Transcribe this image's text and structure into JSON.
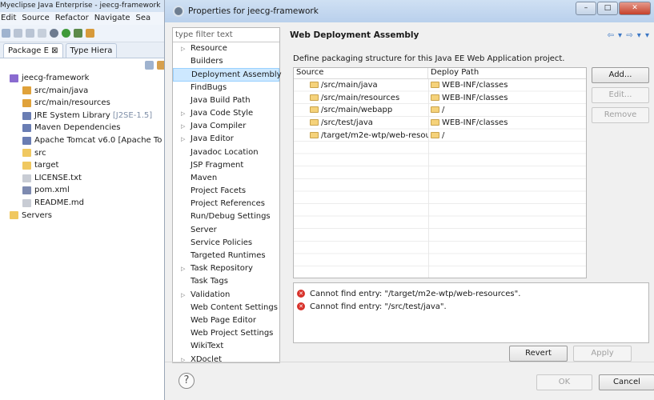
{
  "ide": {
    "title": "Myeclipse Java Enterprise - jeecg-framework",
    "menu": [
      "Edit",
      "Source",
      "Refactor",
      "Navigate",
      "Sea"
    ],
    "tabs": [
      "Package E",
      "Type Hiera"
    ],
    "tree": [
      {
        "label": "jeecg-framework",
        "extra": "",
        "indent": 0,
        "color": "#8a6bd0"
      },
      {
        "label": "src/main/java",
        "extra": "",
        "indent": 1,
        "color": "#e0a23a"
      },
      {
        "label": "src/main/resources",
        "extra": "",
        "indent": 1,
        "color": "#e0a23a"
      },
      {
        "label": "JRE System Library",
        "extra": "[J2SE-1.5]",
        "indent": 1,
        "color": "#6a7db3"
      },
      {
        "label": "Maven Dependencies",
        "extra": "",
        "indent": 1,
        "color": "#6a7db3"
      },
      {
        "label": "Apache Tomcat v6.0 [Apache To",
        "extra": "",
        "indent": 1,
        "color": "#6a7db3"
      },
      {
        "label": "src",
        "extra": "",
        "indent": 1,
        "color": "#f0c860"
      },
      {
        "label": "target",
        "extra": "",
        "indent": 1,
        "color": "#f0c860"
      },
      {
        "label": "LICENSE.txt",
        "extra": "",
        "indent": 1,
        "color": "#c8ccd4"
      },
      {
        "label": "pom.xml",
        "extra": "",
        "indent": 1,
        "color": "#7d8ab0"
      },
      {
        "label": "README.md",
        "extra": "",
        "indent": 1,
        "color": "#c8ccd4"
      },
      {
        "label": "Servers",
        "extra": "",
        "indent": 0,
        "color": "#f0c860"
      }
    ]
  },
  "dialog": {
    "title": "Properties for jeecg-framework",
    "filter_placeholder": "type filter text",
    "nav": [
      {
        "label": "Resource",
        "exp": true
      },
      {
        "label": "Builders",
        "exp": false
      },
      {
        "label": "Deployment Assembly",
        "exp": false,
        "selected": true
      },
      {
        "label": "FindBugs",
        "exp": false
      },
      {
        "label": "Java Build Path",
        "exp": false
      },
      {
        "label": "Java Code Style",
        "exp": true
      },
      {
        "label": "Java Compiler",
        "exp": true
      },
      {
        "label": "Java Editor",
        "exp": true
      },
      {
        "label": "Javadoc Location",
        "exp": false
      },
      {
        "label": "JSP Fragment",
        "exp": false
      },
      {
        "label": "Maven",
        "exp": false
      },
      {
        "label": "Project Facets",
        "exp": false
      },
      {
        "label": "Project References",
        "exp": false
      },
      {
        "label": "Run/Debug Settings",
        "exp": false
      },
      {
        "label": "Server",
        "exp": false
      },
      {
        "label": "Service Policies",
        "exp": false
      },
      {
        "label": "Targeted Runtimes",
        "exp": false
      },
      {
        "label": "Task Repository",
        "exp": true
      },
      {
        "label": "Task Tags",
        "exp": false
      },
      {
        "label": "Validation",
        "exp": true
      },
      {
        "label": "Web Content Settings",
        "exp": false
      },
      {
        "label": "Web Page Editor",
        "exp": false
      },
      {
        "label": "Web Project Settings",
        "exp": false
      },
      {
        "label": "WikiText",
        "exp": false
      },
      {
        "label": "XDoclet",
        "exp": true
      }
    ],
    "page_title": "Web Deployment Assembly",
    "description": "Define packaging structure for this Java EE Web Application project.",
    "columns": {
      "source": "Source",
      "deploy": "Deploy Path"
    },
    "rows": [
      {
        "source": "/src/main/java",
        "deploy": "WEB-INF/classes"
      },
      {
        "source": "/src/main/resources",
        "deploy": "WEB-INF/classes"
      },
      {
        "source": "/src/main/webapp",
        "deploy": "/"
      },
      {
        "source": "/src/test/java",
        "deploy": "WEB-INF/classes"
      },
      {
        "source": "/target/m2e-wtp/web-resourc",
        "deploy": "/"
      }
    ],
    "buttons": {
      "add": "Add...",
      "edit": "Edit...",
      "remove": "Remove",
      "revert": "Revert",
      "apply": "Apply",
      "ok": "OK",
      "cancel": "Cancel"
    },
    "errors": [
      "Cannot find entry: \"/target/m2e-wtp/web-resources\".",
      "Cannot find entry: \"/src/test/java\"."
    ]
  }
}
